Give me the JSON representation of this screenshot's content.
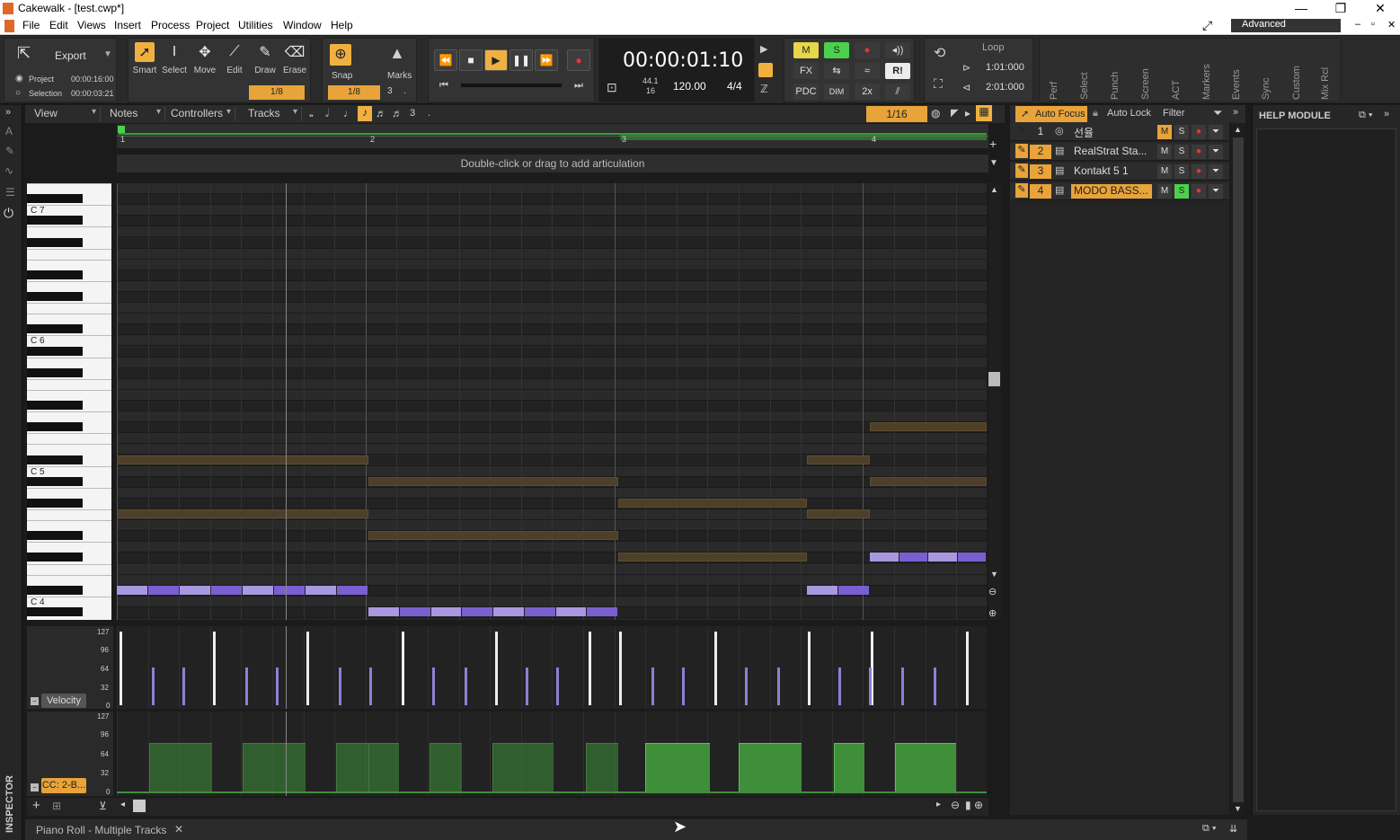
{
  "window": {
    "title": "Cakewalk - [test.cwp*]",
    "buttons": [
      "—",
      "❐",
      "✕"
    ]
  },
  "menu": [
    "File",
    "Edit",
    "Views",
    "Insert",
    "Process",
    "Project",
    "Utilities",
    "Window",
    "Help"
  ],
  "workspace": "Advanced",
  "controlbar": {
    "export_label": "Export",
    "project_label": "Project",
    "project_time": "00:00:16:00",
    "selection_label": "Selection",
    "selection_time": "00:00:03:21",
    "tools": [
      "Smart",
      "Select",
      "Move",
      "Edit",
      "Draw",
      "Erase"
    ],
    "tool_snap": "1/8",
    "snap_label": "Snap",
    "snap_value": "1/8",
    "snap_triplet": "3",
    "snap_dot": ".",
    "marks_label": "Marks",
    "time": "00:00:01:10",
    "sample_rate": "44.1",
    "bit_depth": "16",
    "tempo": "120.00",
    "meter": "4/4",
    "mix": {
      "m": "M",
      "s": "S",
      "fx": "FX",
      "pdc": "PDC",
      "dim": "DIM",
      "twox": "2x",
      "r": "R!"
    },
    "loop_label": "Loop",
    "loop_start": "1:01:000",
    "loop_end": "2:01:000",
    "modules": [
      "Perf",
      "Select",
      "Punch",
      "Screen",
      "ACT",
      "Markers",
      "Events",
      "Sync",
      "Custom",
      "Mix Rcl"
    ]
  },
  "pianoroll": {
    "menus": [
      "View",
      "Notes",
      "Controllers",
      "Tracks"
    ],
    "tuplet": "3",
    "dot": ".",
    "snap": "1/16",
    "auto_focus": "Auto Focus",
    "auto_lock": "Auto Lock",
    "filter": "Filter",
    "ruler": [
      "1",
      "2",
      "3",
      "4"
    ],
    "articulation_hint": "Double-click or drag to add articulation",
    "octave_labels": [
      "C 7",
      "C 6",
      "C 5",
      "C 4"
    ],
    "velocity_label": "Velocity",
    "cc_label": "CC: 2-B...",
    "axis_ticks": [
      "127",
      "96",
      "64",
      "32",
      "0"
    ],
    "tab_label": "Piano Roll - Multiple Tracks",
    "inspector": "INSPECTOR"
  },
  "tracks": [
    {
      "num": "1",
      "name": "선율",
      "m": "M",
      "s": "S",
      "color": "#888888"
    },
    {
      "num": "2",
      "name": "RealStrat Sta...",
      "m": "M",
      "s": "S",
      "color": "#e8a33a"
    },
    {
      "num": "3",
      "name": "Kontakt 5 1",
      "m": "M",
      "s": "S",
      "color": "#e8a33a"
    },
    {
      "num": "4",
      "name": "MODO BASS...",
      "m": "M",
      "s": "S",
      "color": "#e8a33a"
    }
  ],
  "help_module": "HELP MODULE",
  "colors": {
    "accent": "#f0b040",
    "note_purple": "#8a6fd8",
    "note_brown": "#5a4a2a",
    "cc_green": "#3f8f3a"
  }
}
